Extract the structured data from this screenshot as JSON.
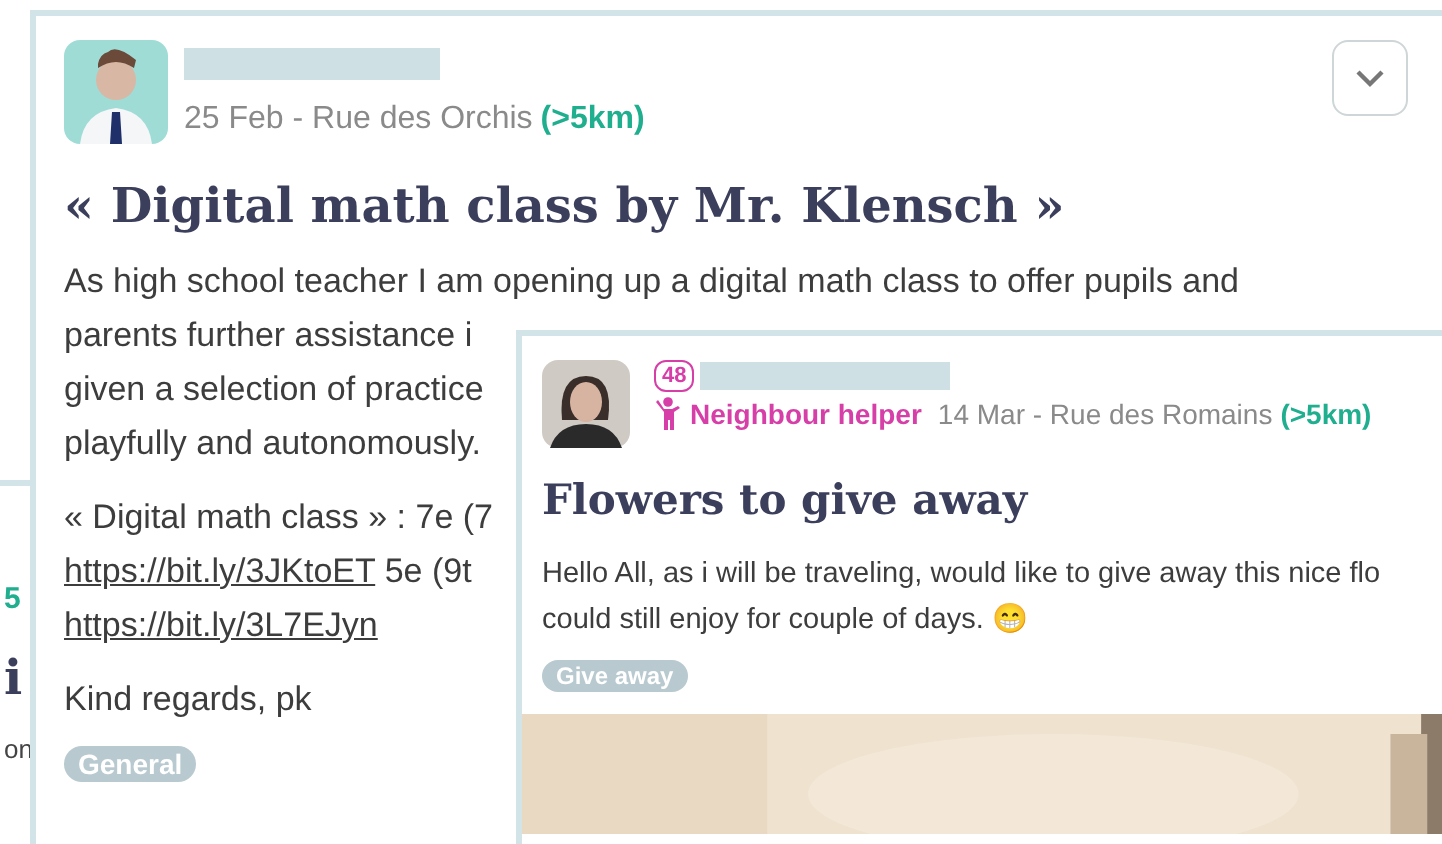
{
  "background_card": {
    "distance": "5",
    "title": "i",
    "text": "on"
  },
  "main_post": {
    "meta": "25 Feb - Rue des Orchis",
    "distance": "(>5km)",
    "title": "« Digital math class by Mr. Klensch »",
    "paragraphs": [
      {
        "lines": [
          [
            {
              "kind": "text",
              "text": "As high school teacher I am opening up a digital math class to offer pupils and"
            }
          ],
          [
            {
              "kind": "text",
              "text": "parents further assistance i"
            }
          ],
          [
            {
              "kind": "text",
              "text": "given a selection of practice"
            }
          ],
          [
            {
              "kind": "text",
              "text": "playfully and autonomously."
            }
          ]
        ]
      },
      {
        "lines": [
          [
            {
              "kind": "text",
              "text": "« Digital math class » : 7e (7"
            }
          ],
          [
            {
              "kind": "link",
              "text": "https://bit.ly/3JKtoET"
            },
            {
              "kind": "text",
              "text": " 5e (9t"
            }
          ],
          [
            {
              "kind": "link",
              "text": "https://bit.ly/3L7EJyn"
            }
          ]
        ]
      },
      {
        "lines": [
          [
            {
              "kind": "text",
              "text": "Kind regards, pk"
            }
          ]
        ]
      }
    ],
    "tag": "General"
  },
  "overlay_post": {
    "badge": "48",
    "role": "Neighbour helper",
    "meta": "14 Mar - Rue des Romains",
    "distance": "(>5km)",
    "title": "Flowers to give away",
    "lines": [
      "Hello All, as i will be traveling, would like to give away this nice flo",
      "could still enjoy for couple of days. 😁"
    ],
    "tag": "Give away",
    "media": {
      "kind": "picture"
    }
  }
}
